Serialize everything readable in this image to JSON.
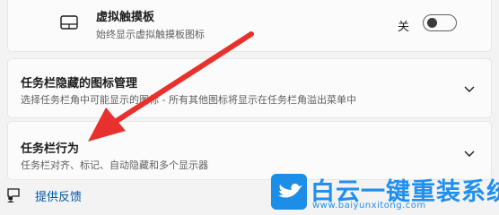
{
  "touchpad": {
    "title": "虚拟触摸板",
    "subtitle": "始终显示虚拟触摸板图标",
    "toggle_label": "关",
    "toggle_on": false,
    "icon": "touchpad-icon"
  },
  "hidden_icons": {
    "title": "任务栏隐藏的图标管理",
    "subtitle": "选择任务栏角中可能显示的图标 - 所有其他图标将显示在任务栏角溢出菜单中",
    "icon": "chevron-down-icon"
  },
  "behaviors": {
    "title": "任务栏行为",
    "subtitle": "任务栏对齐、标记、自动隐藏和多个显示器",
    "icon": "chevron-down-icon"
  },
  "feedback": {
    "label": "提供反馈",
    "icon": "feedback-icon"
  },
  "watermark": {
    "name": "白云一键重装系统",
    "url": "www.baiyunxitong.com",
    "icon": "bird-icon"
  },
  "colors": {
    "accent_link": "#0056a8",
    "arrow": "#e8302c",
    "watermark": "#1f8ff0"
  }
}
